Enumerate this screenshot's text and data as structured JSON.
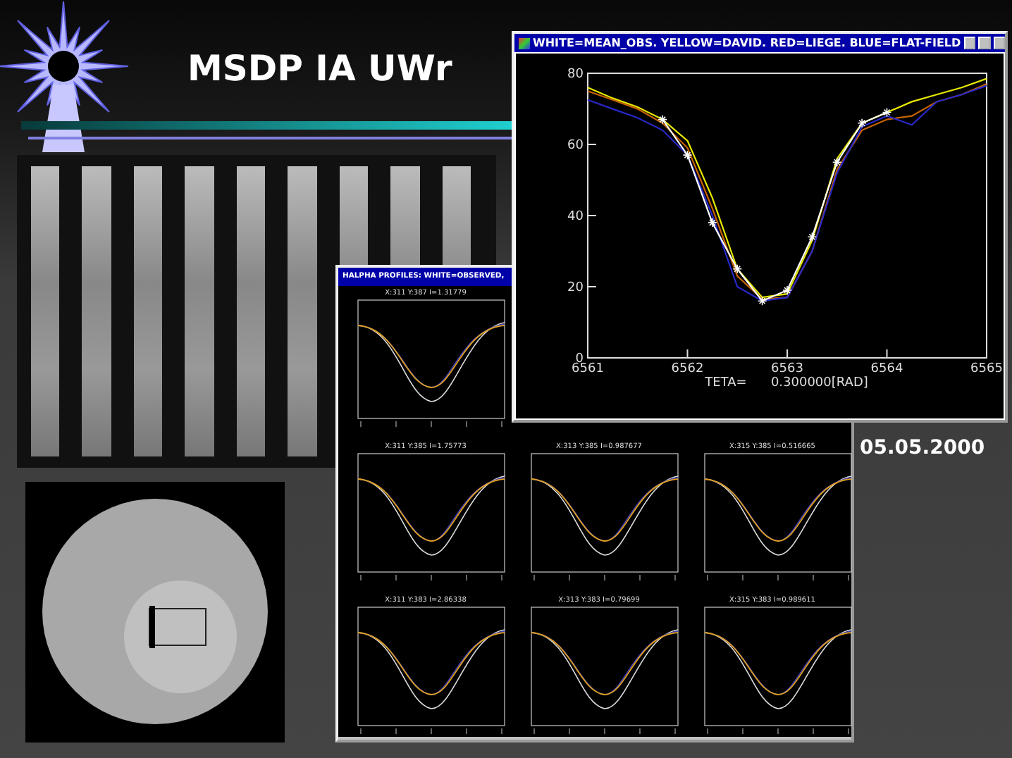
{
  "slide": {
    "title": "MSDP IA UWr",
    "date": "05.05.2000"
  },
  "profiles_window": {
    "title": "HALPHA PROFILES: WHITE=OBSERVED,",
    "plots": [
      {
        "title": "X:311  Y:387  I=1.31779"
      },
      {
        "title": "X:311  Y:385  I=1.75773"
      },
      {
        "title": "X:313  Y:385  I=0.987677"
      },
      {
        "title": "X:315  Y:385  I=0.516665"
      },
      {
        "title": "X:311  Y:383  I=2.86338"
      },
      {
        "title": "X:313  Y:383  I=0.79699"
      },
      {
        "title": "X:315  Y:383  I=0.989611"
      }
    ]
  },
  "mean_window": {
    "title": "WHITE=MEAN_OBS. YELLOW=DAVID. RED=LIEGE. BLUE=FLAT-FIELD",
    "chart_data": {
      "type": "line",
      "xlabel": "TETA=      0.300000[RAD]",
      "xlim": [
        6561,
        6565
      ],
      "ylim": [
        0,
        80
      ],
      "xticks": [
        6561,
        6562,
        6563,
        6564,
        6565
      ],
      "yticks": [
        0,
        20,
        40,
        60,
        80
      ],
      "x": [
        6561,
        6561.25,
        6561.5,
        6561.75,
        6562,
        6562.25,
        6562.5,
        6562.75,
        6563,
        6563.25,
        6563.5,
        6563.75,
        6564,
        6564.25,
        6564.5,
        6564.75,
        6565
      ],
      "series": [
        {
          "color": "#e8e800",
          "values": [
            76,
            73,
            70.5,
            67,
            61,
            45,
            25,
            17,
            18,
            33,
            56,
            66,
            69,
            72,
            74,
            76,
            78.5
          ]
        },
        {
          "color": "#c86400",
          "values": [
            75,
            72.5,
            70,
            66,
            59,
            42,
            23,
            16.5,
            17,
            30,
            53,
            64,
            67,
            68,
            72,
            74,
            77
          ]
        },
        {
          "color": "#2828c8",
          "values": [
            72.5,
            70,
            67.5,
            64,
            57,
            40,
            20,
            16,
            17,
            30,
            52,
            65,
            68,
            65.5,
            72,
            74,
            76.5
          ]
        },
        {
          "color": "#ffffff",
          "marker": "cross",
          "values": [
            null,
            null,
            null,
            67,
            57,
            38,
            25,
            16,
            19,
            34,
            55,
            66,
            69,
            null,
            null,
            null,
            null
          ]
        }
      ]
    }
  }
}
